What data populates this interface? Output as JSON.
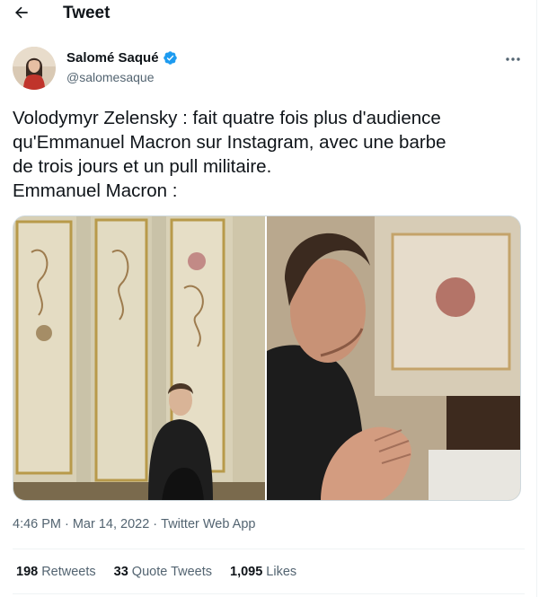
{
  "header": {
    "back_icon": "arrow-left-icon",
    "title": "Tweet"
  },
  "author": {
    "display_name": "Salomé Saqué",
    "handle": "@salomesaque",
    "verified_icon": "verified-badge-icon",
    "more_icon": "more-horizontal-icon"
  },
  "tweet": {
    "lines": [
      "Volodymyr Zelensky : fait quatre fois plus d'audience",
      "qu'Emmanuel Macron sur Instagram, avec une barbe",
      "de trois jours et un pull militaire.",
      "Emmanuel Macron :"
    ]
  },
  "media": {
    "count": 2
  },
  "meta": {
    "time": "4:46 PM",
    "sep1": "·",
    "date": "Mar 14, 2022",
    "sep2": "·",
    "source": "Twitter Web App"
  },
  "stats": {
    "retweets_count": "198",
    "retweets_label": "Retweets",
    "quotes_count": "33",
    "quotes_label": "Quote Tweets",
    "likes_count": "1,095",
    "likes_label": "Likes"
  },
  "colors": {
    "text": "#0f1419",
    "secondary": "#536471",
    "verified": "#1d9bf0",
    "divider": "#eff3f4"
  }
}
